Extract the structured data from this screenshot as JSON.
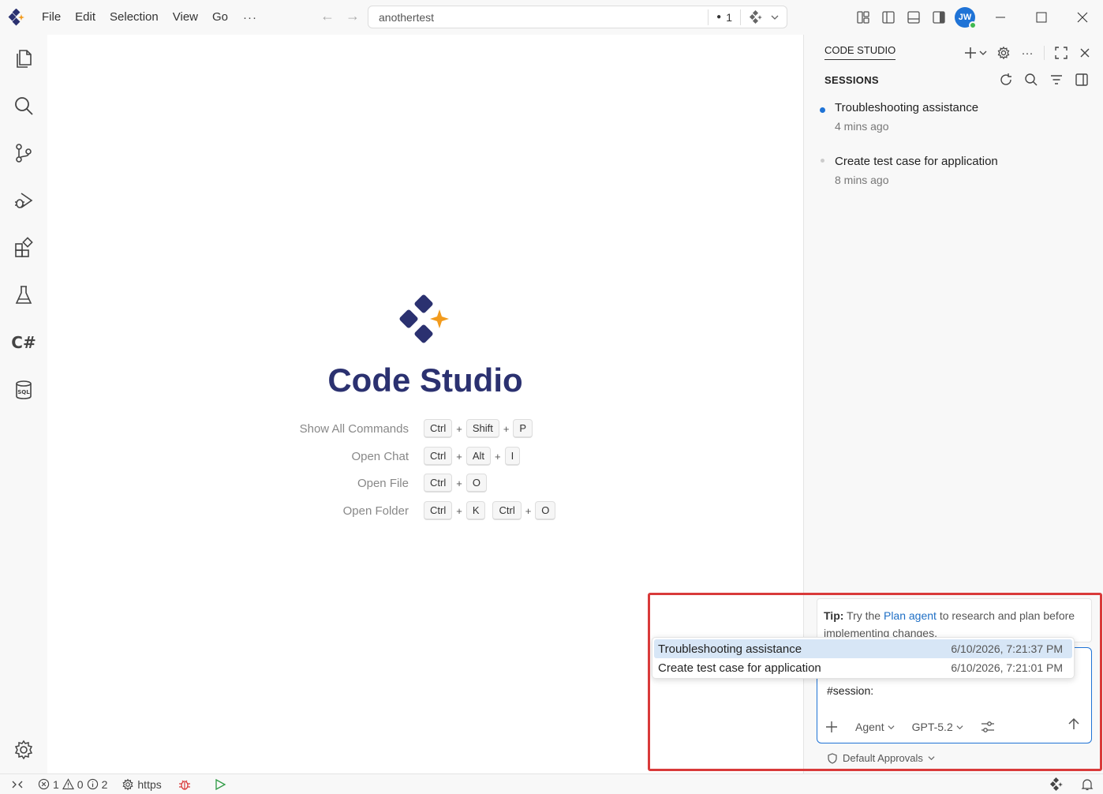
{
  "menu": {
    "items": [
      "File",
      "Edit",
      "Selection",
      "View",
      "Go"
    ],
    "more": "···"
  },
  "command_center": {
    "search_text": "anothertest",
    "status_count": "1"
  },
  "account": {
    "initials": "JW"
  },
  "editor": {
    "title": "Code Studio",
    "shortcuts": [
      {
        "label": "Show All Commands",
        "keys": [
          "Ctrl",
          "Shift",
          "P"
        ]
      },
      {
        "label": "Open Chat",
        "keys": [
          "Ctrl",
          "Alt",
          "I"
        ]
      },
      {
        "label": "Open File",
        "keys": [
          "Ctrl",
          "O"
        ]
      },
      {
        "label": "Open Folder",
        "keys": [
          "Ctrl",
          "K",
          "Ctrl",
          "O"
        ]
      }
    ],
    "plus": "+"
  },
  "panel": {
    "tab_label": "CODE STUDIO",
    "sessions_header": "SESSIONS",
    "sessions": [
      {
        "title": "Troubleshooting assistance",
        "time": "4 mins ago",
        "active": true
      },
      {
        "title": "Create test case for application",
        "time": "8 mins ago",
        "active": false
      }
    ]
  },
  "chat": {
    "tip_prefix": "Tip:",
    "tip_pre_link": "Try the",
    "tip_link": "Plan agent",
    "tip_post_link": "to research and plan before implementing changes.",
    "input_text": "#session:",
    "mode": "Agent",
    "model": "GPT-5.2",
    "approvals": "Default Approvals"
  },
  "dropdown": {
    "items": [
      {
        "title": "Troubleshooting assistance",
        "date": "6/10/2026, 7:21:37 PM"
      },
      {
        "title": "Create test case for application",
        "date": "6/10/2026, 7:21:01 PM"
      }
    ]
  },
  "statusbar": {
    "errors": "1",
    "warnings": "0",
    "infos": "2",
    "branch": "https"
  },
  "colors": {
    "accent": "#1f73d6",
    "brand_navy": "#2b3170",
    "brand_orange": "#f29b1d",
    "highlight": "#d93a3a",
    "session_active": "#1f73d6"
  }
}
